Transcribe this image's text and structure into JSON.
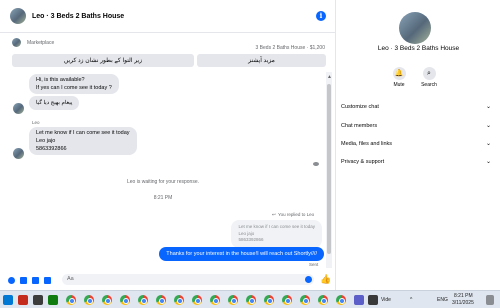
{
  "header": {
    "title": "Leo · 3 Beds 2 Baths House",
    "info_icon": "info-icon"
  },
  "marketplace": {
    "label": "Marketplace",
    "listing": "3 Beds 2 Baths House · $1,200"
  },
  "quick_replies": [
    "زیر التوا کے بطور نشان زد کریں",
    "مزید آپشنز"
  ],
  "messages": {
    "m1": [
      "Hi, is this available?",
      "If yes can I come see it today ?"
    ],
    "m2": "پیغام بھیج دیا گیا",
    "leo_label": "Leo",
    "m3": [
      "Let me know if I can come see it today",
      "Leo jajo",
      "5863392866"
    ],
    "waiting": "Leo is waiting for your response.",
    "time": "8:21 PM",
    "replied": "You replied to Leo",
    "quoted": [
      "Let me know if I can come see it today",
      "Leo jajo",
      "5863392866"
    ],
    "outgoing": "Thanks for your interest in the house!I will reach out Shortly////",
    "status": "Sent"
  },
  "composer": {
    "placeholder": "Aa"
  },
  "side": {
    "name": "Leo · 3 Beds 2 Baths House",
    "actions": [
      {
        "label": "Mute",
        "icon": "bell-icon"
      },
      {
        "label": "Search",
        "icon": "search-icon"
      }
    ],
    "menu": [
      "Customize chat",
      "Chat members",
      "Media, files and links",
      "Privacy & support"
    ]
  },
  "taskbar": {
    "search_text": "Vide",
    "lang": "ENG",
    "clock_time": "8:21 PM",
    "clock_date": "3/11/2025"
  },
  "colors": {
    "accent": "#0866ff",
    "bubble_in": "#e4e6eb",
    "taskbar": "#dfe6ef"
  }
}
